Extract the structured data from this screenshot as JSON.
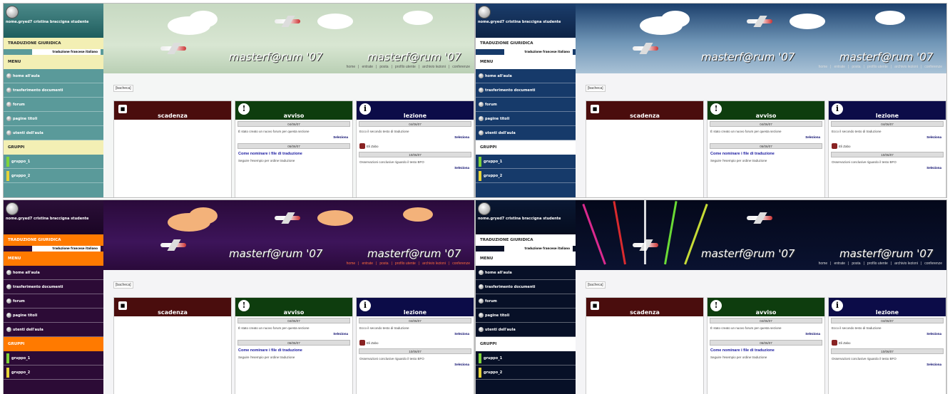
{
  "themes": [
    {
      "sb_top": "#4c8a8a",
      "sb_top2": "#1f5e5e",
      "section_bg": "#f3efb4",
      "menu_bg": "#f3efb4",
      "item_bg": "#5a9a9a",
      "header_bg": "linear-gradient(180deg,#c7d9c2 0%, #d8e6d2 60%, #b9cfb4 100%)",
      "content_bg": "#f4f6f5",
      "nav_color": "#555"
    },
    {
      "sb_top": "#1b3d6b",
      "sb_top2": "#0d2346",
      "section_bg": "#ffffff",
      "menu_bg": "#ffffff",
      "item_bg": "#163a6a",
      "header_bg": "linear-gradient(180deg,#1b3f6c 0%, #6f95b6 55%, #a9c2d6 100%)",
      "content_bg": "#f4f4f6",
      "nav_color": "#ddd"
    },
    {
      "sb_top": "#2b0f38",
      "sb_top2": "#1a0524",
      "section_bg": "#ff7a00",
      "menu_bg": "#ff7a00",
      "item_bg": "#2c0b36",
      "header_bg": "linear-gradient(180deg,#2a0a3a 0%, #3d145a 60%, #2a0a3a 100%)",
      "content_bg": "#f4f4f6",
      "nav_color": "#ff6a3a"
    },
    {
      "sb_top": "#0a1833",
      "sb_top2": "#050c1e",
      "section_bg": "#ffffff",
      "menu_bg": "#ffffff",
      "item_bg": "#071027",
      "header_bg": "linear-gradient(180deg,#04081a 0%, #0a1230 100%)",
      "content_bg": "#f4f4f6",
      "nav_color": "#ddd"
    }
  ],
  "sidebar": {
    "user": "nome.gryed7 cristina braccigna studente",
    "section": "TRADUZIONE GIURIDICA",
    "sub": "traduzione francese italiano",
    "menu_head": "MENU",
    "items": [
      "home all'aula",
      "trasferimento documenti",
      "forum",
      "pagine titoli",
      "utenti dell'aula"
    ],
    "group_head": "GRUPPI",
    "groups": [
      "gruppo_1",
      "gruppo_2"
    ]
  },
  "header": {
    "brand": "masterf@rum '07",
    "nav": [
      "home",
      "entrate",
      "posta",
      "profilo utente",
      "archivio lezioni",
      "conferenze"
    ]
  },
  "breadcrumb": "[bacheca]",
  "boxes": {
    "scadenza": {
      "title": "scadenza",
      "icon": "■"
    },
    "avviso": {
      "title": "avviso",
      "icon": "!",
      "date1": "04/06/07",
      "msg1": "È stato creato un nuovo forum per questa sezione",
      "readmore": "Seleziona",
      "date2": "06/06/07",
      "link": "Come nominare i file di traduzione",
      "msg2": "Seguire l'esempio per ordine traduzione"
    },
    "lezione": {
      "title": "lezione",
      "icon": "i",
      "date1": "04/06/07",
      "msg1": "Ecco il secondo testo di traduzione",
      "readmore": "Seleziona",
      "user": "Eli Zabo",
      "date2": "10/06/07",
      "msg2": "Osservazioni conclusive riguardo il testo BFO",
      "readmore2": "Seleziona"
    }
  }
}
